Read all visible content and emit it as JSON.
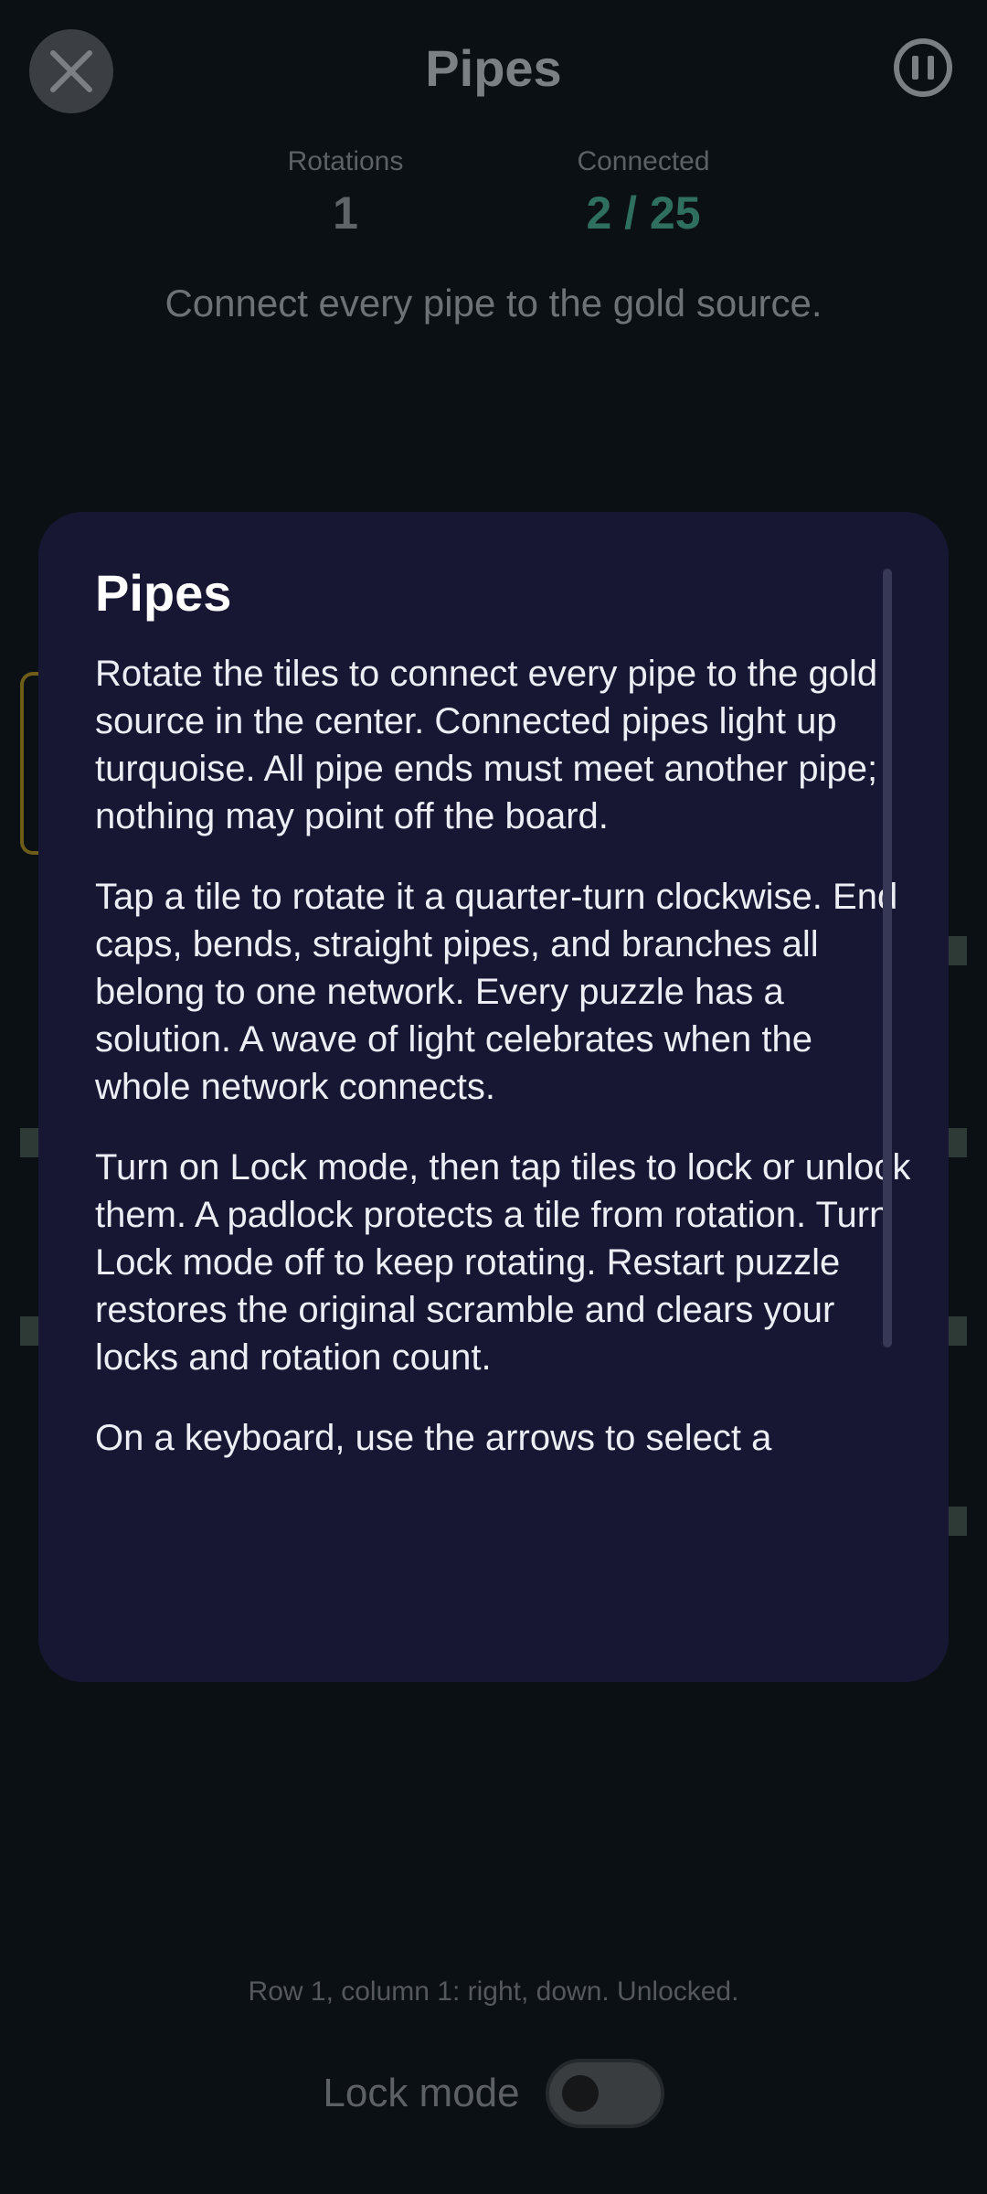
{
  "header": {
    "title": "Pipes"
  },
  "stats": {
    "rotations_label": "Rotations",
    "rotations_value": "1",
    "connected_label": "Connected",
    "connected_value": "2 / 25"
  },
  "hint": "Connect every pipe to the gold source.",
  "modal": {
    "title": "Pipes",
    "paragraphs": [
      "Rotate the tiles to connect every pipe to the gold source in the center. Connected pipes light up turquoise. All pipe ends must meet another pipe; nothing may point off the board.",
      "Tap a tile to rotate it a quarter-turn clockwise. End caps, bends, straight pipes, and branches all belong to one network. Every puzzle has a solution. A wave of light celebrates when the whole network connects.",
      "Turn on Lock mode, then tap tiles to lock or unlock them. A padlock protects a tile from rotation. Turn Lock mode off to keep rotating. Restart puzzle restores the original scramble and clears your locks and rotation count.",
      "On a keyboard, use the arrows to select a"
    ]
  },
  "status_line": "Row 1, column 1: right, down. Unlocked.",
  "lock_mode": {
    "label": "Lock mode",
    "on": false
  },
  "icons": {
    "close": "close-icon",
    "pause": "pause-icon"
  },
  "colors": {
    "connected_value": "#2f6f5e",
    "gold_border": "#6d5d18",
    "modal_bg": "#171734"
  }
}
